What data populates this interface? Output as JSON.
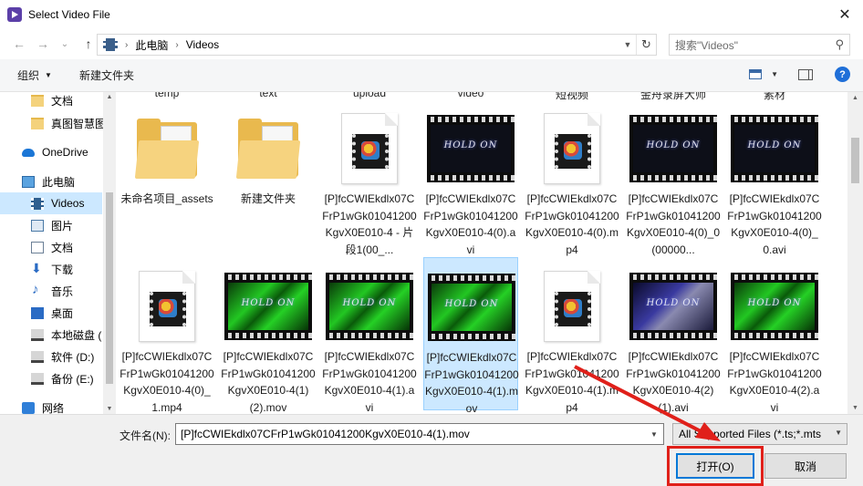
{
  "window": {
    "title": "Select Video File",
    "close_glyph": "✕"
  },
  "nav": {
    "back_glyph": "←",
    "forward_glyph": "→",
    "recent_glyph": "⌄",
    "up_glyph": "↑",
    "breadcrumb": [
      "此电脑",
      "Videos"
    ],
    "refresh_glyph": "↻",
    "search_placeholder": "搜索\"Videos\""
  },
  "toolbar": {
    "organize": "组织",
    "new_folder": "新建文件夹"
  },
  "sidebar": {
    "items": [
      {
        "label": "文档",
        "icon": "folder-icon"
      },
      {
        "label": "真图智慧图",
        "icon": "folder-icon"
      },
      {
        "label": "OneDrive",
        "icon": "onedrive-icon"
      },
      {
        "label": "此电脑",
        "icon": "computer-icon"
      },
      {
        "label": "Videos",
        "icon": "video-library-icon",
        "selected": true
      },
      {
        "label": "图片",
        "icon": "pictures-icon"
      },
      {
        "label": "文档",
        "icon": "documents-icon"
      },
      {
        "label": "下载",
        "icon": "download-icon"
      },
      {
        "label": "音乐",
        "icon": "music-icon"
      },
      {
        "label": "桌面",
        "icon": "desktop-icon"
      },
      {
        "label": "本地磁盘 (",
        "icon": "drive-icon"
      },
      {
        "label": "软件 (D:)",
        "icon": "drive-icon"
      },
      {
        "label": "备份 (E:)",
        "icon": "drive-icon"
      },
      {
        "label": "网络",
        "icon": "network-icon"
      }
    ]
  },
  "top_row_clipped": [
    "temp",
    "text",
    "upload",
    "video",
    "短视频",
    "金舟录屏大师",
    "素材"
  ],
  "files_row1": [
    {
      "name": "未命名项目_assets",
      "kind": "folder"
    },
    {
      "name": "新建文件夹",
      "kind": "folder"
    },
    {
      "name": "[P]fcCWIEkdlx07CFrP1wGk01041200KgvX0E010-4 - 片段1(00_...",
      "kind": "doc"
    },
    {
      "name": "[P]fcCWIEkdlx07CFrP1wGk01041200KgvX0E010-4(0).avi",
      "kind": "video-dark"
    },
    {
      "name": "[P]fcCWIEkdlx07CFrP1wGk01041200KgvX0E010-4(0).mp4",
      "kind": "doc"
    },
    {
      "name": "[P]fcCWIEkdlx07CFrP1wGk01041200KgvX0E010-4(0)_0(00000...",
      "kind": "video-dark"
    },
    {
      "name": "[P]fcCWIEkdlx07CFrP1wGk01041200KgvX0E010-4(0)_0.avi",
      "kind": "video-dark"
    }
  ],
  "files_row2": [
    {
      "name": "[P]fcCWIEkdlx07CFrP1wGk01041200KgvX0E010-4(0)_1.mp4",
      "kind": "doc"
    },
    {
      "name": "[P]fcCWIEkdlx07CFrP1wGk01041200KgvX0E010-4(1) (2).mov",
      "kind": "video-green"
    },
    {
      "name": "[P]fcCWIEkdlx07CFrP1wGk01041200KgvX0E010-4(1).avi",
      "kind": "video-green"
    },
    {
      "name": "[P]fcCWIEkdlx07CFrP1wGk01041200KgvX0E010-4(1).mov",
      "kind": "video-green",
      "selected": true
    },
    {
      "name": "[P]fcCWIEkdlx07CFrP1wGk01041200KgvX0E010-4(1).mp4",
      "kind": "doc"
    },
    {
      "name": "[P]fcCWIEkdlx07CFrP1wGk01041200KgvX0E010-4(2)(1).avi",
      "kind": "video-blue"
    },
    {
      "name": "[P]fcCWIEkdlx07CFrP1wGk01041200KgvX0E010-4(2).avi",
      "kind": "video-green"
    }
  ],
  "video_logo_text": "HOLD ON",
  "bottom": {
    "filename_label": "文件名(N):",
    "filename_value": "[P]fcCWIEkdlx07CFrP1wGk01041200KgvX0E010-4(1).mov",
    "filetype_value": "All Supported Files (*.ts;*.mts",
    "open_label": "打开(O)",
    "cancel_label": "取消"
  },
  "colors": {
    "selection": "#cce8ff",
    "accent": "#0078d7",
    "annotation_red": "#e0201a"
  }
}
